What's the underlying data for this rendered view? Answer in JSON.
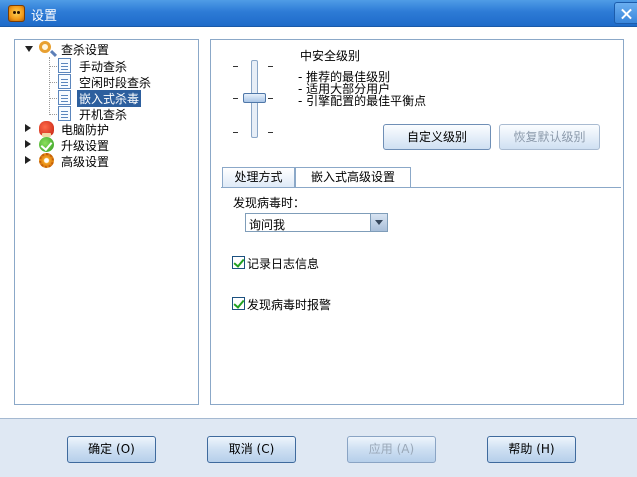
{
  "window": {
    "title": "设置"
  },
  "tree": {
    "items": [
      {
        "label": "查杀设置",
        "expanded": true
      },
      {
        "label": "手动查杀"
      },
      {
        "label": "空闲时段查杀"
      },
      {
        "label": "嵌入式杀毒",
        "selected": true
      },
      {
        "label": "开机查杀"
      },
      {
        "label": "电脑防护"
      },
      {
        "label": "升级设置"
      },
      {
        "label": "高级设置"
      }
    ]
  },
  "security": {
    "level_title": "中安全级别",
    "desc": [
      "- 推荐的最佳级别",
      "- 适用大部分用户",
      "- 引擎配置的最佳平衡点"
    ],
    "custom_button": "自定义级别",
    "restore_button": "恢复默认级别",
    "slider_level": "middle"
  },
  "tabs": [
    {
      "label": "处理方式",
      "active": true
    },
    {
      "label": "嵌入式高级设置",
      "active": false
    }
  ],
  "handling": {
    "on_virus_label": "发现病毒时：",
    "on_virus_value": "询问我",
    "log_label": "记录日志信息",
    "log_checked": true,
    "alarm_label": "发现病毒时报警",
    "alarm_checked": true
  },
  "footer": {
    "ok": "确定",
    "ok_key": "(O)",
    "cancel": "取消",
    "cancel_key": "(C)",
    "apply": "应用",
    "apply_key": "(A)",
    "help": "帮助",
    "help_key": "(H)"
  },
  "colors": {
    "titlebar": "#2d7bd6",
    "selection": "#2d5f9e",
    "footer": "#dfe8f3",
    "panel_border": "#8ba8c8"
  }
}
